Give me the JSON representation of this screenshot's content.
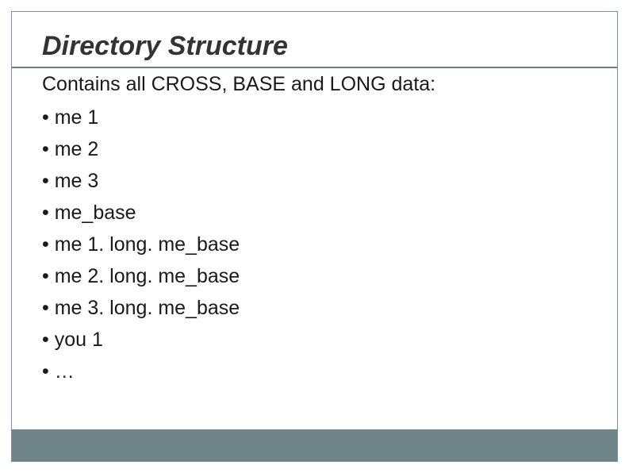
{
  "slide": {
    "title": "Directory Structure",
    "intro": "Contains all CROSS, BASE and LONG data:",
    "bullets": [
      "me 1",
      "me 2",
      "me 3",
      "me_base",
      "me 1. long. me_base",
      "me 2. long. me_base",
      "me 3. long. me_base",
      "you 1",
      "…"
    ]
  }
}
